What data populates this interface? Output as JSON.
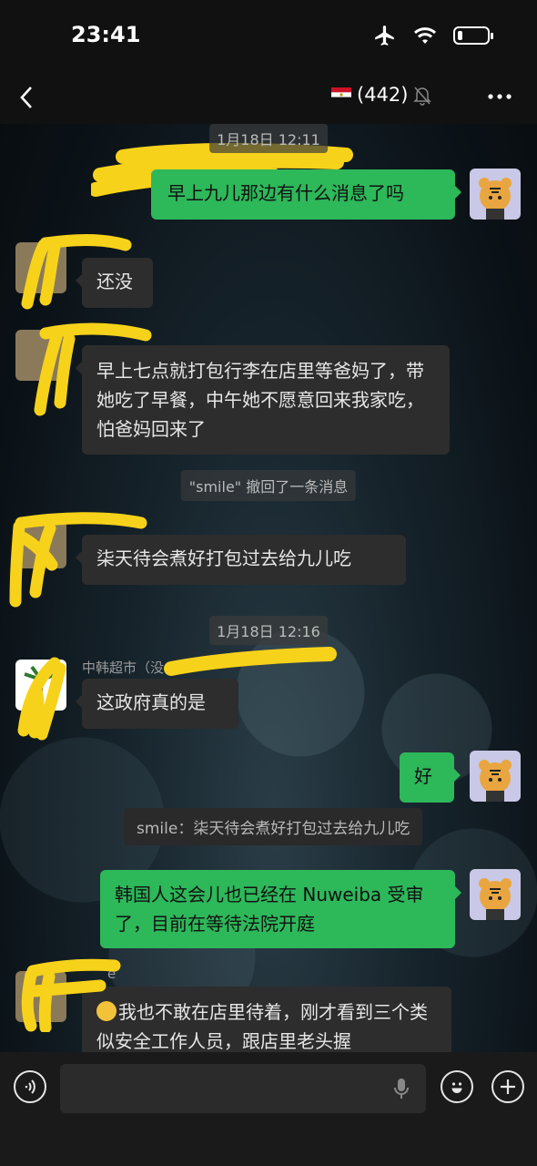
{
  "status_bar": {
    "time": "23:41"
  },
  "header": {
    "member_count": "(442)"
  },
  "messages": {
    "ts1": "1月18日 12:11",
    "m1": "早上九儿那边有什么消息了吗",
    "m2": "还没",
    "m3": "早上七点就打包行李在店里等爸妈了，带她吃了早餐，中午她不愿意回来我家吃，怕爸妈回来了",
    "recall": "\"smile\" 撤回了一条消息",
    "m4": "柒天待会煮好打包过去给九儿吃",
    "ts2": "1月18日 12:16",
    "sender5": "中韩超市（没",
    "m5": "这政府真的是",
    "m6": "好",
    "quote6": "smile：柒天待会煮好打包过去给九儿吃",
    "m7": "韩国人这会儿也已经在 Nuweiba 受审了，目前在等待法院开庭",
    "sender8": "e",
    "m8": "我也不敢在店里待着，刚才看到三个类似安全工作人员，跟店里老头握"
  },
  "icons": {
    "back": "chevron-left-icon",
    "more": "more-dots-icon",
    "airplane": "airplane-icon",
    "wifi": "wifi-icon",
    "battery": "battery-icon",
    "mute": "mute-bell-icon",
    "voice": "voice-icon",
    "mic": "mic-icon",
    "emoji": "emoji-icon",
    "plus": "plus-icon"
  },
  "colors": {
    "outgoing_bubble": "#2db85a",
    "incoming_bubble": "#2d2d2d",
    "redaction": "#f7d21a"
  }
}
